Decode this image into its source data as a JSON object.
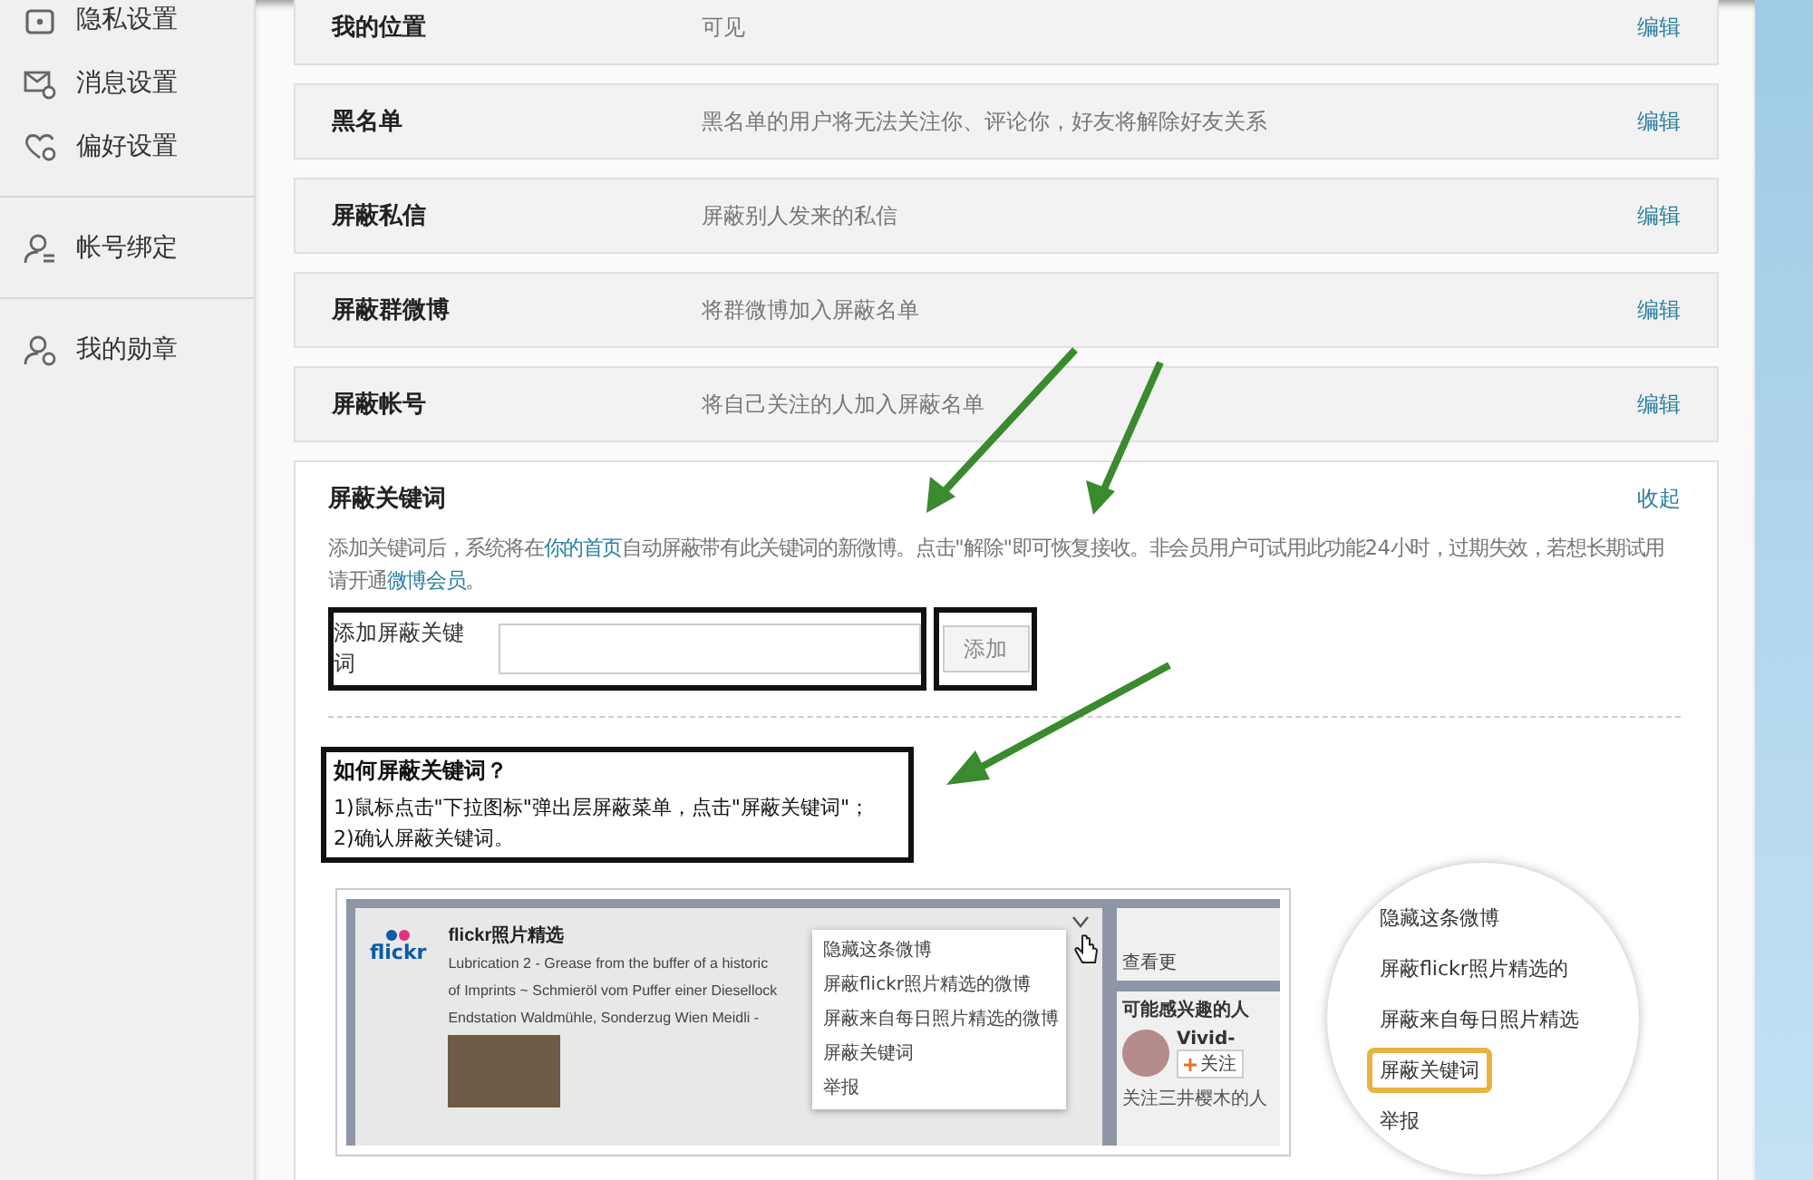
{
  "sidebar": {
    "groups": [
      [
        {
          "label": "隐私设置"
        },
        {
          "label": "消息设置"
        },
        {
          "label": "偏好设置"
        }
      ],
      [
        {
          "label": "帐号绑定"
        }
      ],
      [
        {
          "label": "我的勋章"
        }
      ]
    ]
  },
  "settings_rows": [
    {
      "title": "我的位置",
      "value": "可见",
      "action": "编辑"
    },
    {
      "title": "黑名单",
      "value": "黑名单的用户将无法关注你、评论你，好友将解除好友关系",
      "action": "编辑"
    },
    {
      "title": "屏蔽私信",
      "value": "屏蔽别人发来的私信",
      "action": "编辑"
    },
    {
      "title": "屏蔽群微博",
      "value": "将群微博加入屏蔽名单",
      "action": "编辑"
    },
    {
      "title": "屏蔽帐号",
      "value": "将自己关注的人加入屏蔽名单",
      "action": "编辑"
    }
  ],
  "keyword_section": {
    "title": "屏蔽关键词",
    "toggle": "收起",
    "description": [
      {
        "kind": "plain",
        "text": "添加关键词后，系统将在"
      },
      {
        "kind": "link",
        "text": "你的首页"
      },
      {
        "kind": "plain",
        "text": "自动屏蔽带有此关键词的新微博。点击\"解除\"即可恢复接收。非会员用户可试用此功能24小时，过期失效，若想长期试用请开通"
      },
      {
        "kind": "link",
        "text": "微博会员"
      },
      {
        "kind": "plain",
        "text": "。"
      }
    ],
    "input_label": "添加屏蔽关键词",
    "button": {
      "label": "添加",
      "disabled": true
    },
    "how_to": {
      "title": "如何屏蔽关键词？",
      "steps": [
        "1)鼠标点击\"下拉图标\"弹出层屏蔽菜单，点击\"屏蔽关键词\"；",
        "2)确认屏蔽关键词。"
      ]
    }
  },
  "example": {
    "logo": "flickr",
    "account": "flickr照片精选",
    "post_lines": [
      "Lubrication 2 - Grease from the buffer of a historic",
      "of Imprints ~ Schmieröl vom Puffer einer Diesellock",
      "Endstation Waldmühle, Sonderzug Wien Meidli -"
    ],
    "menu": [
      {
        "label": "隐藏这条微博"
      },
      {
        "label": "屏蔽flickr照片精选的微博"
      },
      {
        "label": "屏蔽来自每日照片精选的微博"
      },
      {
        "label": "屏蔽关键词"
      },
      {
        "label": "举报"
      }
    ],
    "side_link": "查看更",
    "side_title": "可能感兴趣的人",
    "user": "Vivid-",
    "follow": "关注",
    "footer": "关注三井樱木的人"
  },
  "magnifier": {
    "items": [
      {
        "label": "隐藏这条微博",
        "selected": false
      },
      {
        "label": "屏蔽flickr照片精选的",
        "selected": false
      },
      {
        "label": "屏蔽来自每日照片精选",
        "selected": false
      },
      {
        "label": "屏蔽关键词",
        "selected": true
      },
      {
        "label": "举报",
        "selected": false
      }
    ]
  }
}
